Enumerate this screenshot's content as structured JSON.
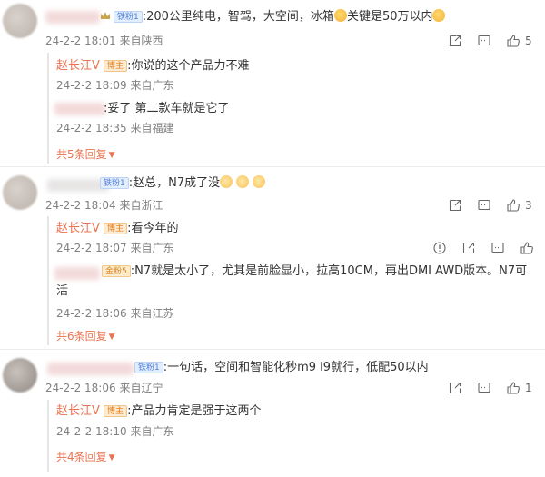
{
  "c1": {
    "text": ":200公里纯电，智驾，大空间，冰箱",
    "text_tail": "关键是50万以内",
    "badge": "铁粉1",
    "date": "24-2-2 18:01",
    "location": "来自陕西",
    "likes": "5",
    "replies": [
      {
        "author": "赵长江V",
        "badge": "博主",
        "text": ":你说的这个产品力不难",
        "date": "24-2-2 18:09",
        "location": "来自广东"
      },
      {
        "text": ":妥了 第二款车就是它了",
        "date": "24-2-2 18:35",
        "location": "来自福建"
      }
    ],
    "more": "共5条回复"
  },
  "c2": {
    "text": ":赵总，N7成了没",
    "badge": "铁粉1",
    "date": "24-2-2 18:04",
    "location": "来自浙江",
    "likes": "3",
    "replies": [
      {
        "author": "赵长江V",
        "badge": "博主",
        "text": ":看今年的",
        "date": "24-2-2 18:07",
        "location": "来自广东"
      },
      {
        "badge": "金粉5",
        "text_line1": ":N7就是太小了，尤其是前脸显小，拉高10CM，再出DMI AWD版本。N7可",
        "text_line2": "活",
        "date": "24-2-2 18:06",
        "location": "来自江苏"
      }
    ],
    "more": "共6条回复"
  },
  "c3": {
    "text": ":一句话，空间和智能化秒m9 l9就行，低配50以内",
    "badge": "铁粉1",
    "date": "24-2-2 18:06",
    "location": "来自辽宁",
    "likes": "1",
    "replies": [
      {
        "author": "赵长江V",
        "badge": "博主",
        "text": ":产品力肯定是强于这两个",
        "date": "24-2-2 18:10",
        "location": "来自广东"
      }
    ],
    "more": "共4条回复"
  },
  "icons": [
    "share-icon",
    "comment-icon",
    "like-icon",
    "report-icon",
    "crown-icon"
  ],
  "colors": {
    "accent": "#eb7350",
    "meta": "#808080",
    "text": "#333333"
  }
}
